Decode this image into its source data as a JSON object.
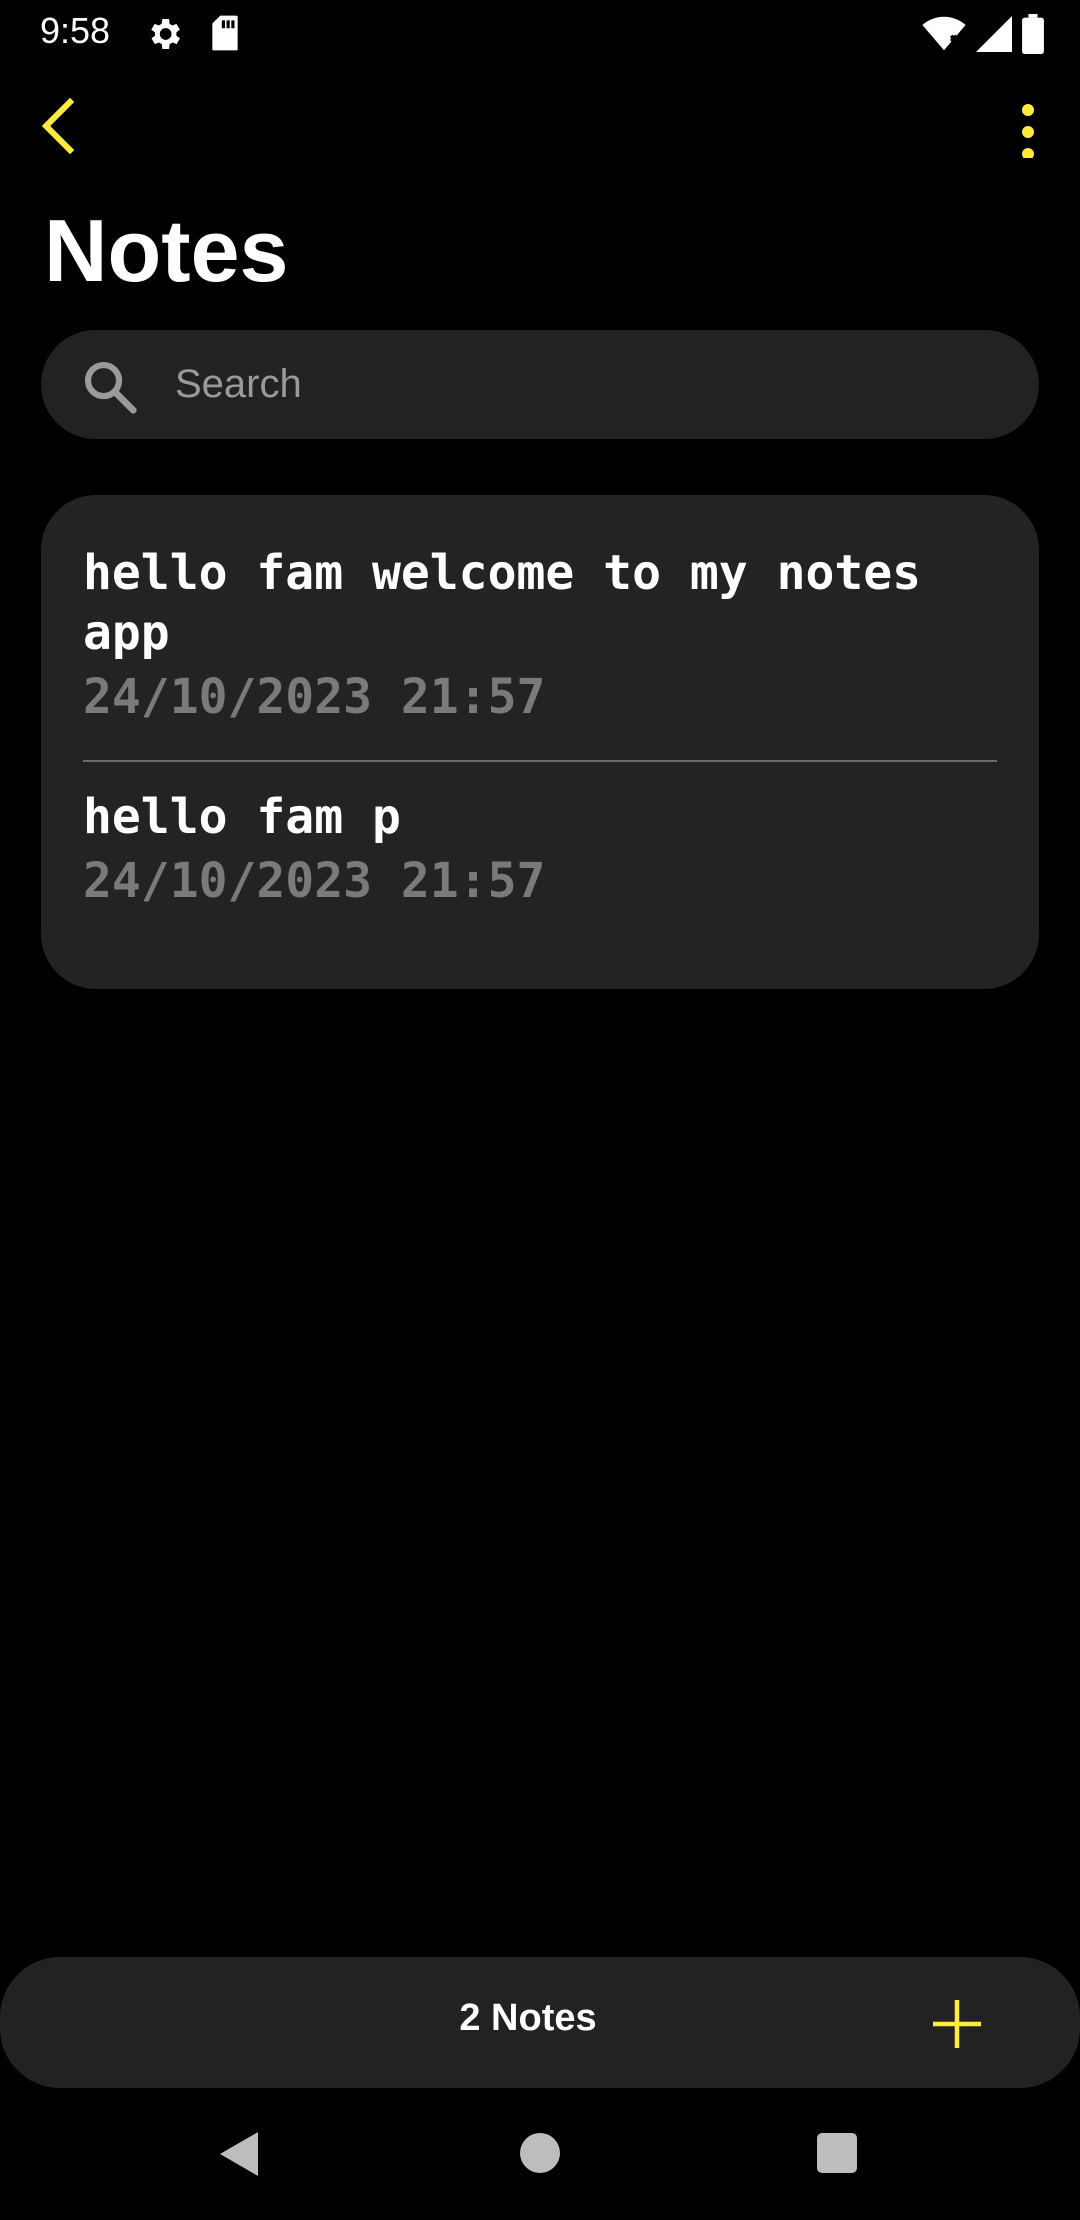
{
  "status_bar": {
    "time": "9:58",
    "icons": [
      "gear-icon",
      "sd-card-icon",
      "wifi-icon",
      "signal-icon",
      "battery-icon"
    ]
  },
  "toolbar": {
    "back_icon": "chevron-left-icon",
    "menu_icon": "more-vert-icon"
  },
  "page": {
    "title": "Notes"
  },
  "search": {
    "placeholder": "Search",
    "value": ""
  },
  "notes": [
    {
      "title": "hello fam welcome to my notes app",
      "date": "24/10/2023 21:57"
    },
    {
      "title": "hello fam p",
      "date": "24/10/2023 21:57"
    }
  ],
  "bottom_bar": {
    "count_label": "2 Notes",
    "add_icon": "plus-icon"
  },
  "colors": {
    "accent": "#FFEB3B",
    "background": "#000000",
    "card": "#232323",
    "date_text": "#7A7A7A"
  }
}
